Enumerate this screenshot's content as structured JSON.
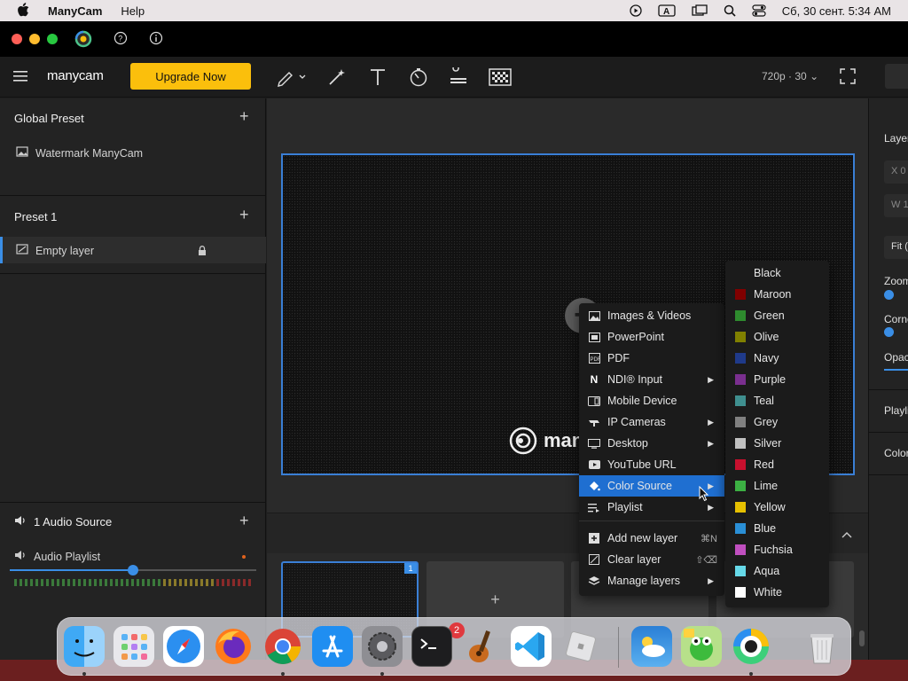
{
  "menubar": {
    "app_name": "ManyCam",
    "menus": [
      "Help"
    ],
    "clock": "Сб, 30 сент.  5:34 AM"
  },
  "toolbar": {
    "logo": "manycam",
    "upgrade_label": "Upgrade Now",
    "resolution": "720p · 30"
  },
  "sidebar": {
    "global_preset": "Global Preset",
    "watermark_item": "Watermark ManyCam",
    "preset1": "Preset 1",
    "empty_layer": "Empty layer",
    "audio_source": "1 Audio Source",
    "audio_playlist": "Audio Playlist",
    "volume": 0.5
  },
  "preview": {
    "watermark_text": "man",
    "thumb_badge": "1"
  },
  "right_panel": {
    "layer": "Layer",
    "x": "X 0",
    "w": "W 1",
    "fit": "Fit (",
    "zoom": "Zoom",
    "corner": "Corne",
    "opacity": "Opac",
    "playlist": "Playli",
    "color": "Color"
  },
  "context_menu": {
    "items": [
      {
        "label": "Images & Videos",
        "icon": "image-icon",
        "submenu": false
      },
      {
        "label": "PowerPoint",
        "icon": "powerpoint-icon",
        "submenu": false
      },
      {
        "label": "PDF",
        "icon": "pdf-icon",
        "submenu": false
      },
      {
        "label": "NDI® Input",
        "icon": "ndi-icon",
        "submenu": true
      },
      {
        "label": "Mobile Device",
        "icon": "mobile-icon",
        "submenu": false
      },
      {
        "label": "IP Cameras",
        "icon": "ip-camera-icon",
        "submenu": true
      },
      {
        "label": "Desktop",
        "icon": "desktop-icon",
        "submenu": true
      },
      {
        "label": "YouTube URL",
        "icon": "youtube-icon",
        "submenu": false
      },
      {
        "label": "Color Source",
        "icon": "paint-bucket-icon",
        "submenu": true,
        "highlighted": true
      },
      {
        "label": "Playlist",
        "icon": "playlist-icon",
        "submenu": true
      }
    ],
    "actions": [
      {
        "label": "Add new layer",
        "icon": "add-layer-icon",
        "shortcut": "⌘N"
      },
      {
        "label": "Clear layer",
        "icon": "clear-layer-icon",
        "shortcut": "⇧⌫"
      },
      {
        "label": "Manage layers",
        "icon": "layers-icon",
        "submenu": true
      }
    ]
  },
  "color_submenu": {
    "colors": [
      {
        "label": "Black",
        "hex": "#000000"
      },
      {
        "label": "Maroon",
        "hex": "#800000"
      },
      {
        "label": "Green",
        "hex": "#2e8b2e"
      },
      {
        "label": "Olive",
        "hex": "#808000"
      },
      {
        "label": "Navy",
        "hex": "#1f3a8a"
      },
      {
        "label": "Purple",
        "hex": "#7a2f8f"
      },
      {
        "label": "Teal",
        "hex": "#3f8f8f"
      },
      {
        "label": "Grey",
        "hex": "#808080"
      },
      {
        "label": "Silver",
        "hex": "#c0c0c0"
      },
      {
        "label": "Red",
        "hex": "#c8102e"
      },
      {
        "label": "Lime",
        "hex": "#3cb043"
      },
      {
        "label": "Yellow",
        "hex": "#e6c000"
      },
      {
        "label": "Blue",
        "hex": "#2a8fd6"
      },
      {
        "label": "Fuchsia",
        "hex": "#c04fbf"
      },
      {
        "label": "Aqua",
        "hex": "#66d9e8"
      },
      {
        "label": "White",
        "hex": "#ffffff"
      }
    ]
  },
  "dock": {
    "apps": [
      "Finder",
      "Launchpad",
      "Safari",
      "Firefox",
      "Chrome",
      "App Store",
      "System Settings",
      "Terminal",
      "GarageBand",
      "VS Code",
      "Roblox",
      "Weather",
      "Frogger",
      "ManyCam",
      "Trash"
    ],
    "settings_badge": "2"
  }
}
